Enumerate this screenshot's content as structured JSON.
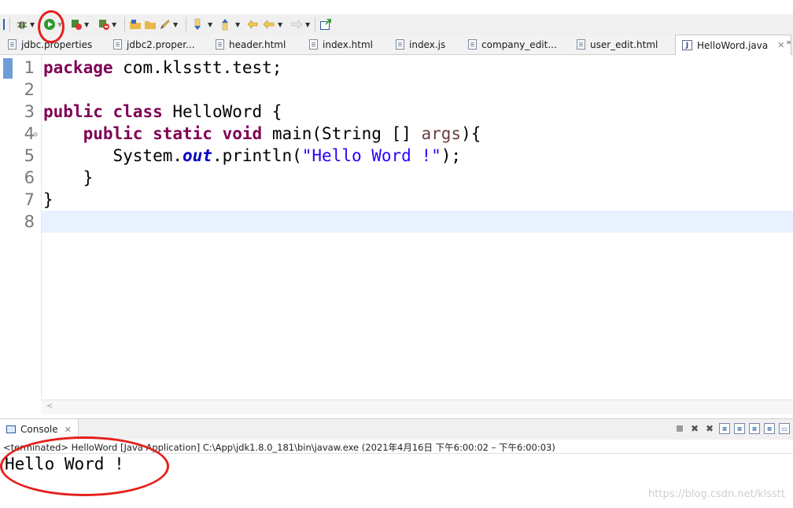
{
  "toolbar": {
    "items": [
      "debug-icon",
      "run-icon",
      "coverage-icon",
      "external-tools-icon",
      "open-folder-icon",
      "edit-icon",
      "next-annotation-icon",
      "prev-annotation-icon",
      "back-icon",
      "forward-icon",
      "new-task-icon"
    ]
  },
  "tabs": [
    {
      "label": "jdbc.properties"
    },
    {
      "label": "jdbc2.proper..."
    },
    {
      "label": "header.html"
    },
    {
      "label": "index.html"
    },
    {
      "label": "index.js"
    },
    {
      "label": "company_edit..."
    },
    {
      "label": "user_edit.html"
    },
    {
      "label": "HelloWord.java",
      "active": true,
      "close": "✕"
    }
  ],
  "tabs_more": "»",
  "editor": {
    "lines": [
      {
        "n": "1",
        "t": [
          {
            "k": "kw",
            "v": "package"
          },
          {
            "k": "",
            "v": " com.klsstt.test;"
          }
        ]
      },
      {
        "n": "2",
        "t": []
      },
      {
        "n": "3",
        "t": [
          {
            "k": "kw",
            "v": "public"
          },
          {
            "k": "",
            "v": " "
          },
          {
            "k": "kw",
            "v": "class"
          },
          {
            "k": "",
            "v": " HelloWord {"
          }
        ]
      },
      {
        "n": "4",
        "fold": "⊖",
        "t": [
          {
            "k": "",
            "v": "    "
          },
          {
            "k": "kw",
            "v": "public"
          },
          {
            "k": "",
            "v": " "
          },
          {
            "k": "kw",
            "v": "static"
          },
          {
            "k": "",
            "v": " "
          },
          {
            "k": "kw",
            "v": "void"
          },
          {
            "k": "",
            "v": " main(String [] "
          },
          {
            "k": "param",
            "v": "args"
          },
          {
            "k": "",
            "v": "){"
          }
        ]
      },
      {
        "n": "5",
        "t": [
          {
            "k": "",
            "v": "       System."
          },
          {
            "k": "field",
            "v": "out"
          },
          {
            "k": "",
            "v": ".println("
          },
          {
            "k": "str",
            "v": "\"Hello Word !\""
          },
          {
            "k": "",
            "v": ");"
          }
        ]
      },
      {
        "n": "6",
        "t": [
          {
            "k": "",
            "v": "    }"
          }
        ]
      },
      {
        "n": "7",
        "t": [
          {
            "k": "",
            "v": "}"
          }
        ]
      },
      {
        "n": "8",
        "t": [],
        "current": true
      }
    ]
  },
  "console": {
    "tab_label": "Console",
    "close": "✕",
    "status": "<terminated> HelloWord [Java Application] C:\\App\\jdk1.8.0_181\\bin\\javaw.exe  (2021年4月16日 下午6:00:02 – 下午6:00:03)",
    "output": "Hello Word !"
  },
  "watermark": "https://blog.csdn.net/klsstt",
  "colors": {
    "keyword": "#7f0055",
    "string": "#2a00ff",
    "field": "#0000c0",
    "annotation": "#e4201d"
  }
}
